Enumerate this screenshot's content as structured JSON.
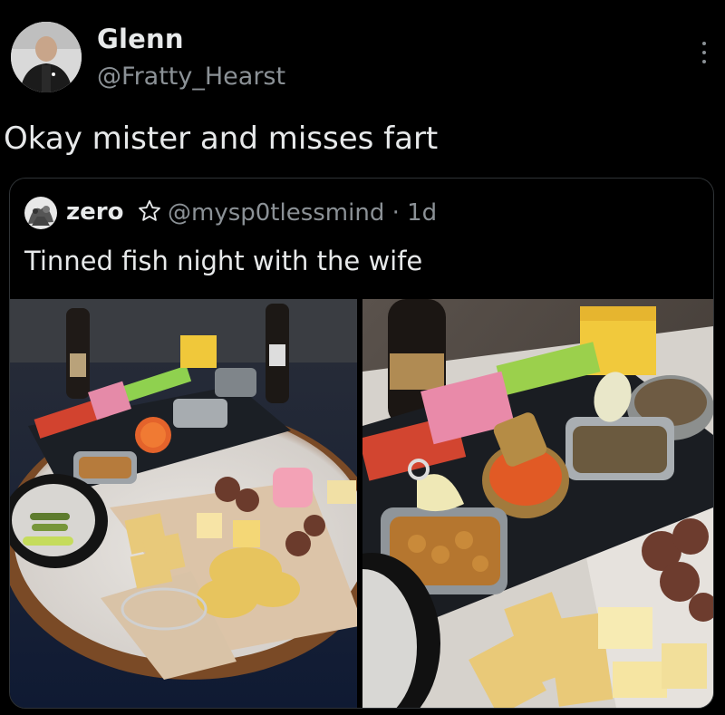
{
  "post": {
    "display_name": "Glenn",
    "handle": "@Fratty_Hearst",
    "text": "Okay mister and misses fart",
    "menu_icon": "more-vertical-icon"
  },
  "quoted_post": {
    "display_name": "zero",
    "badge_icon": "star-outline-icon",
    "handle_and_time": "@mysp0tlessmind · 1d",
    "text": "Tinned fish night with the wife",
    "photos": [
      {
        "label": "Tinned fish charcuterie board on round table"
      },
      {
        "label": "Close-up of tinned fish board"
      }
    ]
  },
  "colors": {
    "background": "#000000",
    "text_primary": "#e7e9ea",
    "text_secondary": "#8b9196",
    "card_border": "#2f3336"
  }
}
